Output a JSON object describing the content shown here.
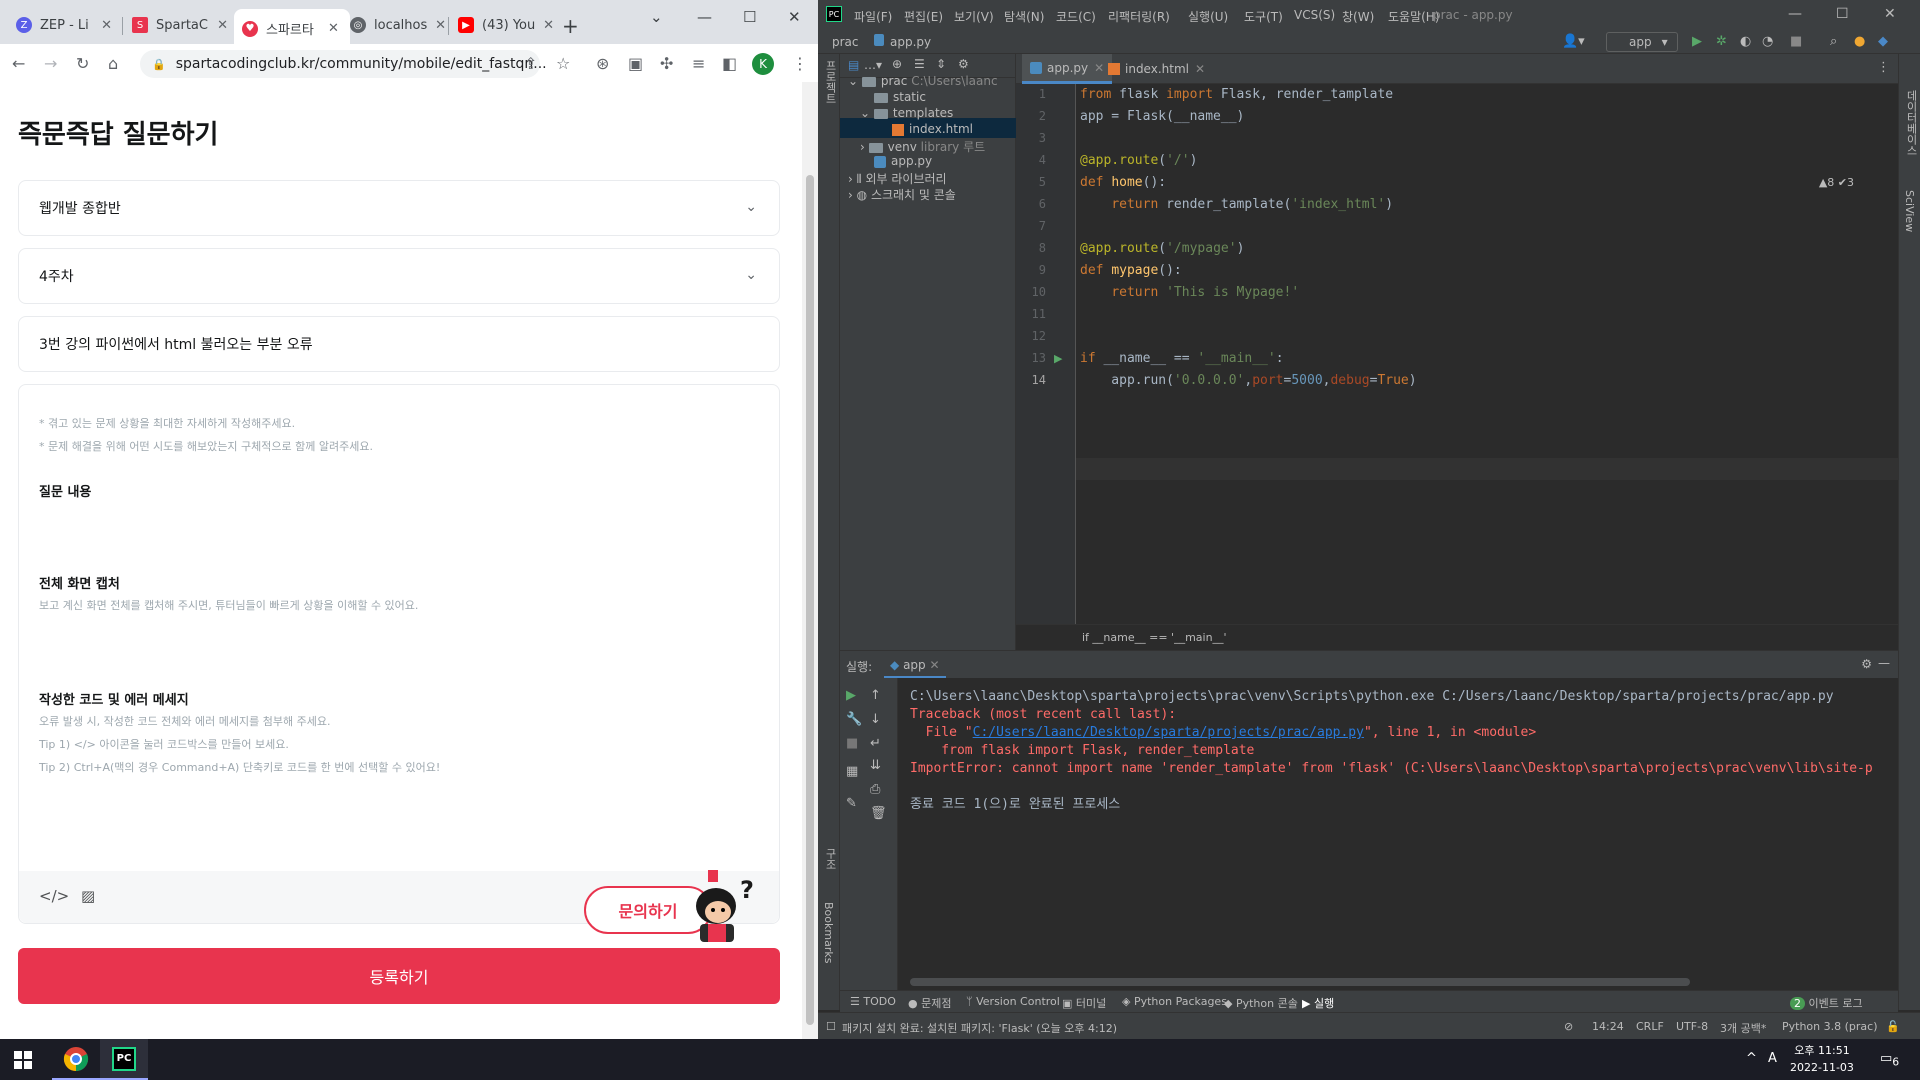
{
  "browser": {
    "tabs": [
      {
        "label": "ZEP - Li",
        "color": "#5b5fe8"
      },
      {
        "label": "SpartaC",
        "color": "#e8344e"
      },
      {
        "label": "스파르타",
        "color": "#e8344e"
      },
      {
        "label": "localhos",
        "color": "#5f6368"
      },
      {
        "label": "(43) You",
        "color": "#ff0000"
      }
    ],
    "url": "spartacodingclub.kr/community/mobile/edit_fastqn...",
    "profile_initial": "K"
  },
  "page": {
    "title": "즉문즉답 질문하기",
    "course_select": "웹개발 종합반",
    "week_select": "4주차",
    "question_title": "3번 강의 파이썬에서 html 불러오는 부분 오류",
    "hint_1": "* 겪고 있는 문제 상황을 최대한 자세하게 작성해주세요.",
    "hint_2": "* 문제 해결을 위해 어떤 시도를 해보았는지 구체적으로 함께 알려주세요.",
    "section_question": "질문 내용",
    "section_capture": "전체 화면 캡처",
    "capture_desc": "보고 계신 화면 전체를 캡처해 주시면, 튜터님들이 빠르게 상황을 이해할 수 있어요.",
    "section_code": "작성한 코드 및 에러 메세지",
    "code_desc": "오류 발생 시, 작성한 코드 전체와 에러 메세지를 첨부해 주세요.",
    "tip_1": "Tip 1) </> 아이콘을 눌러 코드박스를 만들어 보세요.",
    "tip_2": "Tip 2) Ctrl+A(맥의 경우 Command+A) 단축키로 코드를 한 번에 선택할 수 있어요!",
    "ask_button": "문의하기",
    "submit_button": "등록하기"
  },
  "ide": {
    "menus": [
      "파일(F)",
      "편집(E)",
      "보기(V)",
      "탐색(N)",
      "코드(C)",
      "리팩터링(R)",
      "실행(U)",
      "도구(T)",
      "VCS(S)",
      "창(W)",
      "도움말(H)"
    ],
    "window_title": "prac - app.py",
    "breadcrumb_project": "prac",
    "breadcrumb_file": "app.py",
    "run_config": "app",
    "project_label": "프로젝트",
    "tree": {
      "root": "prac",
      "root_path": "C:\\Users\\laanc",
      "static": "static",
      "templates": "templates",
      "index": "index.html",
      "venv": "venv",
      "venv_note": "library 루트",
      "app": "app.py",
      "ext_libs": "외부 라이브러리",
      "scratch": "스크래치 및 콘솔"
    },
    "editor_tabs": [
      "app.py",
      "index.html"
    ],
    "inspections": "▲8 ✔3",
    "code_breadcrumb": "if __name__ == '__main__'",
    "run_label": "실행:",
    "run_tab": "app",
    "console": {
      "cmd": "C:\\Users\\laanc\\Desktop\\sparta\\projects\\prac\\venv\\Scripts\\python.exe C:/Users/laanc/Desktop/sparta/projects/prac/app.py",
      "tb": "Traceback (most recent call last):",
      "file_prefix": "  File \"",
      "file_link": "C:/Users/laanc/Desktop/sparta/projects/prac/app.py",
      "file_suffix": "\", line 1, in <module>",
      "code": "    from flask import Flask, render_template",
      "error": "ImportError: cannot import name 'render_tamplate' from 'flask' (C:\\Users\\laanc\\Desktop\\sparta\\projects\\prac\\venv\\lib\\site-p",
      "exit": "종료 코드 1(으)로 완료된 프로세스"
    },
    "toolwindows": [
      "TODO",
      "문제점",
      "Version Control",
      "터미널",
      "Python Packages",
      "Python 콘솔",
      "실행"
    ],
    "event_log": "이벤트 로그",
    "event_count": "2",
    "status_msg": "패키지 설치 완료: 설치된 패키지: 'Flask' (오늘 오후 4:12)",
    "status_pos": "14:24",
    "status_eol": "CRLF",
    "status_enc": "UTF-8",
    "status_indent": "3개 공백*",
    "status_interp": "Python 3.8 (prac)",
    "left_strip": [
      "프로젝트",
      "구조",
      "Bookmarks"
    ],
    "right_strip": [
      "데이터베이스",
      "SciView"
    ]
  },
  "taskbar": {
    "time": "오후 11:51",
    "date": "2022-11-03",
    "ime": "A",
    "notif": "6"
  }
}
